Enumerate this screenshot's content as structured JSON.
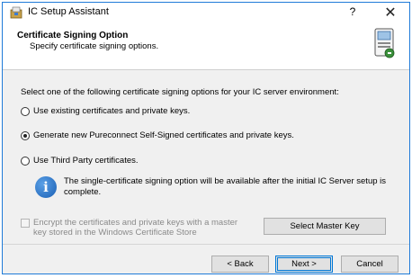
{
  "window": {
    "title": "IC Setup Assistant",
    "help_label": "?",
    "close_label": "✕"
  },
  "header": {
    "title": "Certificate Signing Option",
    "subtitle": "Specify certificate signing options."
  },
  "main": {
    "prompt": "Select one of the following certificate signing options for your IC server environment:",
    "options": [
      {
        "label": "Use existing certificates and private keys.",
        "checked": false
      },
      {
        "label": "Generate new Pureconnect Self-Signed certificates and private keys.",
        "checked": true
      },
      {
        "label": "Use Third Party certificates.",
        "checked": false
      }
    ],
    "info": {
      "icon": "info-icon",
      "glyph": "i",
      "text": "The single-certificate signing option will be available after the initial IC Server setup is complete."
    },
    "encrypt": {
      "label": "Encrypt the certificates and private keys with a master key stored in the Windows Certificate Store",
      "checked": false,
      "enabled": false
    },
    "master_key_button": "Select Master Key"
  },
  "footer": {
    "back": "< Back",
    "next": "Next >",
    "cancel": "Cancel"
  },
  "colors": {
    "accent": "#0078d7",
    "info": "#1a5fb4",
    "disabled_text": "#8a8a8a"
  }
}
